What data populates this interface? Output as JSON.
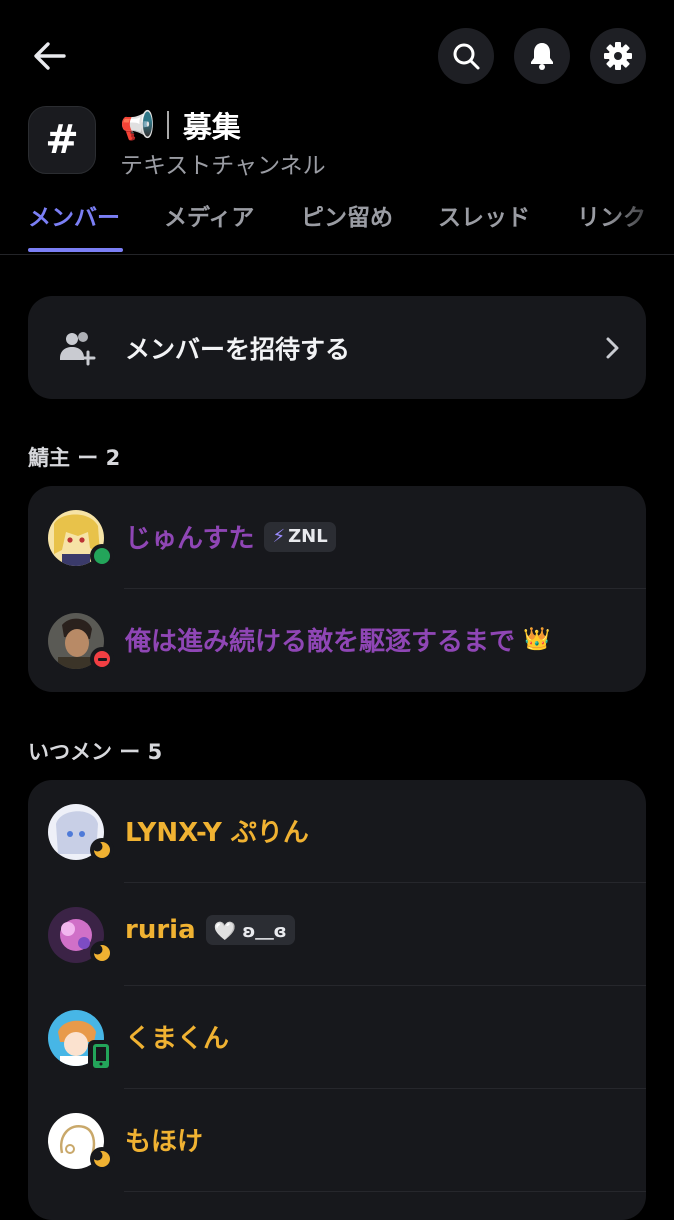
{
  "header": {
    "back_icon": "arrow-left-icon",
    "search_icon": "search-icon",
    "bell_icon": "bell-icon",
    "settings_icon": "gear-icon"
  },
  "channel": {
    "icon_glyph": "#",
    "emoji": "📢",
    "name": "募集",
    "subtitle": "テキストチャンネル"
  },
  "tabs": [
    {
      "label": "メンバー",
      "active": true
    },
    {
      "label": "メディア"
    },
    {
      "label": "ピン留め"
    },
    {
      "label": "スレッド"
    },
    {
      "label": "リンク"
    }
  ],
  "invite": {
    "label": "メンバーを招待する"
  },
  "sections": [
    {
      "title": "鯖主 ー 2",
      "members": [
        {
          "name": "じゅんすた",
          "tag": "ZNL",
          "tag_icon": "⚡",
          "status": "online",
          "color": "#8f46b5"
        },
        {
          "name": "俺は進み続ける敵を駆逐するまで",
          "suffix": "👑",
          "status": "dnd",
          "color": "#8f46b5"
        }
      ]
    },
    {
      "title": "いつメン ー 5",
      "members": [
        {
          "name": "LYNX-Y ぷりん",
          "status": "idle",
          "color": "#f0b232"
        },
        {
          "name": "ruria",
          "tag": "🤍 ʚ＿ɞ",
          "status": "idle",
          "color": "#f0b232"
        },
        {
          "name": "くまくん",
          "status": "mobile-online",
          "color": "#f0b232"
        },
        {
          "name": "もほけ",
          "status": "idle",
          "color": "#f0b232"
        }
      ]
    }
  ],
  "colors": {
    "accent": "#7b7ff5",
    "online": "#23a55a",
    "dnd": "#f23f43",
    "idle": "#f0b232"
  }
}
